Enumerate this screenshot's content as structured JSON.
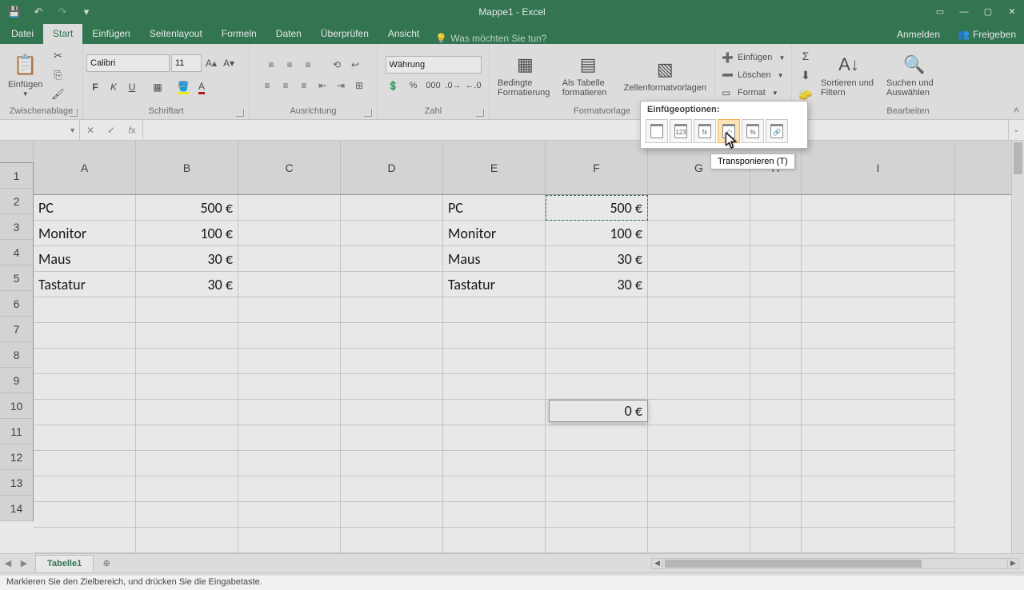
{
  "app": {
    "title": "Mappe1 - Excel"
  },
  "qat": {
    "save": "💾",
    "undo": "↶",
    "redo": "↷"
  },
  "tabs": {
    "file": "Datei",
    "home": "Start",
    "insert": "Einfügen",
    "pagelayout": "Seitenlayout",
    "formulas": "Formeln",
    "data": "Daten",
    "review": "Überprüfen",
    "view": "Ansicht",
    "tellme": "Was möchten Sie tun?",
    "signin": "Anmelden",
    "share": "Freigeben"
  },
  "ribbon": {
    "clipboard": {
      "paste": "Einfügen",
      "label": "Zwischenablage"
    },
    "font": {
      "name": "Calibri",
      "size": "11",
      "label": "Schriftart"
    },
    "alignment": {
      "label": "Ausrichtung"
    },
    "number": {
      "format": "Währung",
      "label": "Zahl"
    },
    "styles": {
      "cond": "Bedingte Formatierung",
      "table": "Als Tabelle formatieren",
      "cellstyles": "Zellenformatvorlagen",
      "label": "Formatvorlage"
    },
    "cells": {
      "insert": "Einfügen",
      "delete": "Löschen",
      "format": "Format"
    },
    "editing": {
      "sortfilter": "Sortieren und Filtern",
      "findselect": "Suchen und Auswählen",
      "label": "Bearbeiten"
    }
  },
  "namebox": "",
  "columns": [
    "A",
    "B",
    "C",
    "D",
    "E",
    "F",
    "G",
    "H",
    "I"
  ],
  "rows": [
    "1",
    "2",
    "3",
    "4",
    "5",
    "6",
    "7",
    "8",
    "9",
    "10",
    "11",
    "12",
    "13",
    "14"
  ],
  "data": {
    "A1": "PC",
    "B1": "500 €",
    "A2": "Monitor",
    "B2": "100 €",
    "A3": "Maus",
    "B3": "30 €",
    "A4": "Tastatur",
    "B4": "30 €",
    "E1": "PC",
    "F1": "500 €",
    "E2": "Monitor",
    "F2": "100 €",
    "E3": "Maus",
    "F3": "30 €",
    "E4": "Tastatur",
    "F4": "30 €"
  },
  "floatcell": "0 €",
  "popup": {
    "title": "Einfügeoptionen:",
    "opts": [
      "",
      "123",
      "fx",
      "⤺",
      "%",
      "🔗"
    ],
    "tooltip": "Transponieren (T)"
  },
  "sheets": {
    "tab1": "Tabelle1"
  },
  "status": "Markieren Sie den Zielbereich, und drücken Sie die Eingabetaste."
}
